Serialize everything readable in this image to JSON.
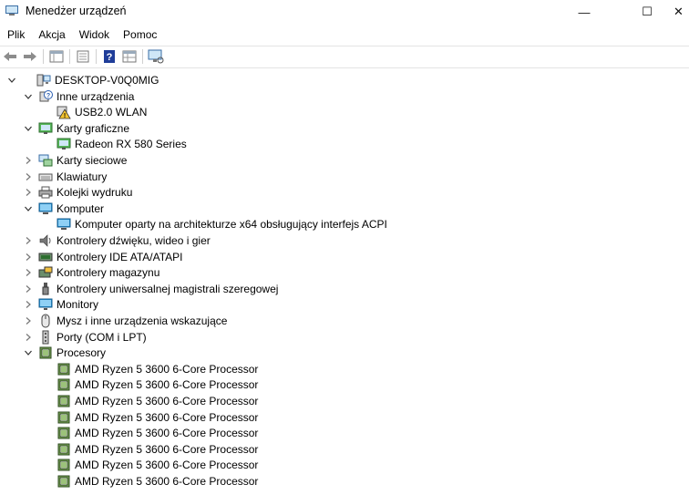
{
  "window": {
    "title": "Menedżer urządzeń",
    "minimize_glyph": "—",
    "maximize_glyph": "☐",
    "close_glyph": "✕"
  },
  "menu": [
    "Plik",
    "Akcja",
    "Widok",
    "Pomoc"
  ],
  "toolbar": [
    "back-icon",
    "forward-icon",
    "properties-icon",
    "view-icon",
    "help-icon",
    "grid-icon",
    "monitor-scan-icon"
  ],
  "tree": {
    "root": "DESKTOP-V0Q0MIG",
    "categories": [
      {
        "label": "Inne urządzenia",
        "expanded": true,
        "icon": "unknown-device-icon",
        "children": [
          "USB2.0 WLAN"
        ],
        "child_icon": "warning-device-icon"
      },
      {
        "label": "Karty graficzne",
        "expanded": true,
        "icon": "display-adapter-icon",
        "children": [
          "Radeon RX 580 Series"
        ],
        "child_icon": "display-adapter-icon"
      },
      {
        "label": "Karty sieciowe",
        "expanded": false,
        "icon": "network-icon"
      },
      {
        "label": "Klawiatury",
        "expanded": false,
        "icon": "keyboard-icon"
      },
      {
        "label": "Kolejki wydruku",
        "expanded": false,
        "icon": "printer-icon"
      },
      {
        "label": "Komputer",
        "expanded": true,
        "icon": "computer-icon",
        "children": [
          "Komputer oparty na architekturze x64 obsługujący interfejs ACPI"
        ],
        "child_icon": "computer-icon"
      },
      {
        "label": "Kontrolery dźwięku, wideo i gier",
        "expanded": false,
        "icon": "speaker-icon"
      },
      {
        "label": "Kontrolery IDE ATA/ATAPI",
        "expanded": false,
        "icon": "ide-icon"
      },
      {
        "label": "Kontrolery magazynu",
        "expanded": false,
        "icon": "storage-icon"
      },
      {
        "label": "Kontrolery uniwersalnej magistrali szeregowej",
        "expanded": false,
        "icon": "usb-icon"
      },
      {
        "label": "Monitory",
        "expanded": false,
        "icon": "monitor-icon"
      },
      {
        "label": "Mysz i inne urządzenia wskazujące",
        "expanded": false,
        "icon": "mouse-icon"
      },
      {
        "label": "Porty (COM i LPT)",
        "expanded": false,
        "icon": "port-icon"
      },
      {
        "label": "Procesory",
        "expanded": true,
        "icon": "processor-icon",
        "children": [
          "AMD Ryzen 5 3600 6-Core Processor",
          "AMD Ryzen 5 3600 6-Core Processor",
          "AMD Ryzen 5 3600 6-Core Processor",
          "AMD Ryzen 5 3600 6-Core Processor",
          "AMD Ryzen 5 3600 6-Core Processor",
          "AMD Ryzen 5 3600 6-Core Processor",
          "AMD Ryzen 5 3600 6-Core Processor",
          "AMD Ryzen 5 3600 6-Core Processor"
        ],
        "child_icon": "processor-icon"
      }
    ]
  }
}
